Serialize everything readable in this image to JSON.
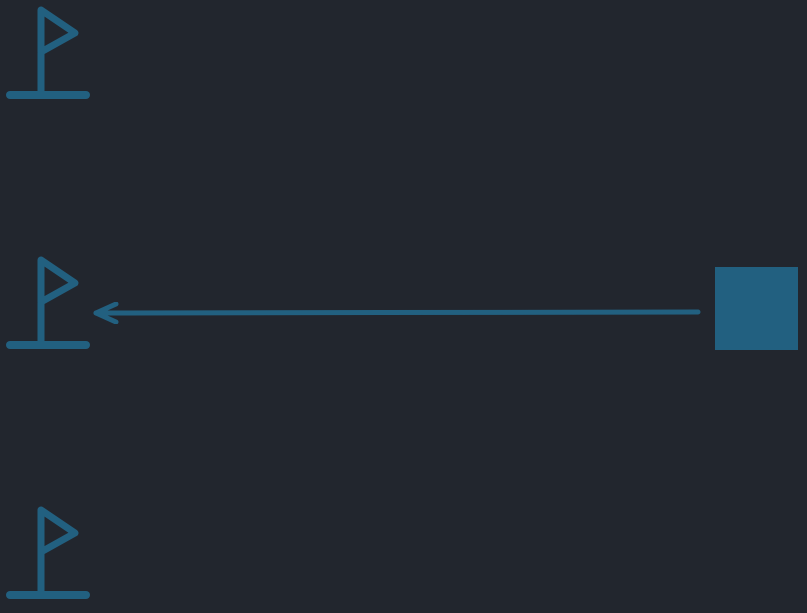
{
  "scene": {
    "background_color": "#22262e",
    "accent_color": "#226080"
  },
  "flags": [
    {
      "icon": "flag-icon"
    },
    {
      "icon": "flag-icon"
    },
    {
      "icon": "flag-icon"
    }
  ],
  "arrow": {
    "icon": "arrow-left-icon",
    "direction": "left"
  },
  "block": {
    "shape": "square"
  }
}
